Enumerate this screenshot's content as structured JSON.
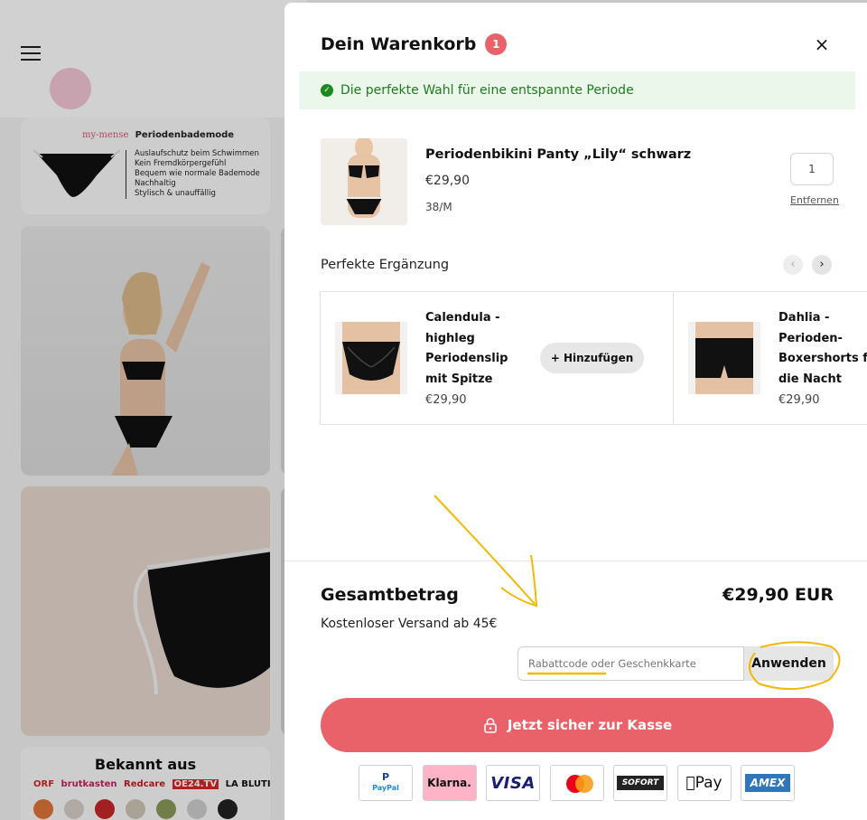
{
  "background": {
    "brand": "my-mense",
    "brand_heading": "Periodenbademode",
    "features": [
      "Auslaufschutz beim Schwimmen",
      "Kein Fremdkörpergefühl",
      "Bequem wie normale Bademode",
      "Nachhaltig",
      "Stylisch & unauffällig"
    ],
    "press_title": "Bekannt aus",
    "press_logos": [
      "ORF",
      "brutkasten",
      "Redcare",
      "OE24.TV",
      "LA BLUTIQUE"
    ]
  },
  "cart": {
    "title": "Dein Warenkorb",
    "count": "1",
    "close_icon": "×",
    "notice": "Die perfekte Wahl für eine entspannte Periode",
    "item": {
      "name": "Periodenbikini Panty „Lily“ schwarz",
      "price": "€29,90",
      "variant": "38/M",
      "quantity": "1",
      "remove_label": "Entfernen"
    },
    "upsell": {
      "title": "Perfekte Ergänzung",
      "prev": "‹",
      "next": "›",
      "products": [
        {
          "name": "Calendula - highleg Periodenslip mit Spitze",
          "price": "€29,90",
          "add_label": "+ Hinzufügen"
        },
        {
          "name": "Dahlia - Perioden-Boxershorts für die Nacht",
          "price": "€29,90"
        }
      ]
    },
    "footer": {
      "total_label": "Gesamtbetrag",
      "total_value": "€29,90 EUR",
      "shipping_note": "Kostenloser Versand ab 45€",
      "discount_placeholder": "Rabattcode oder Geschenkkarte",
      "apply_label": "Anwenden",
      "checkout_label": "Jetzt sicher zur Kasse",
      "payment_methods": [
        "PayPal",
        "Klarna.",
        "VISA",
        "Mastercard",
        "SOFORT",
        "Apple Pay",
        "AMEX"
      ]
    }
  },
  "colors": {
    "accent": "#e96169",
    "notice_bg": "#eaf7ea",
    "notice_text": "#1d7d1d",
    "annotation": "#f2b806"
  }
}
